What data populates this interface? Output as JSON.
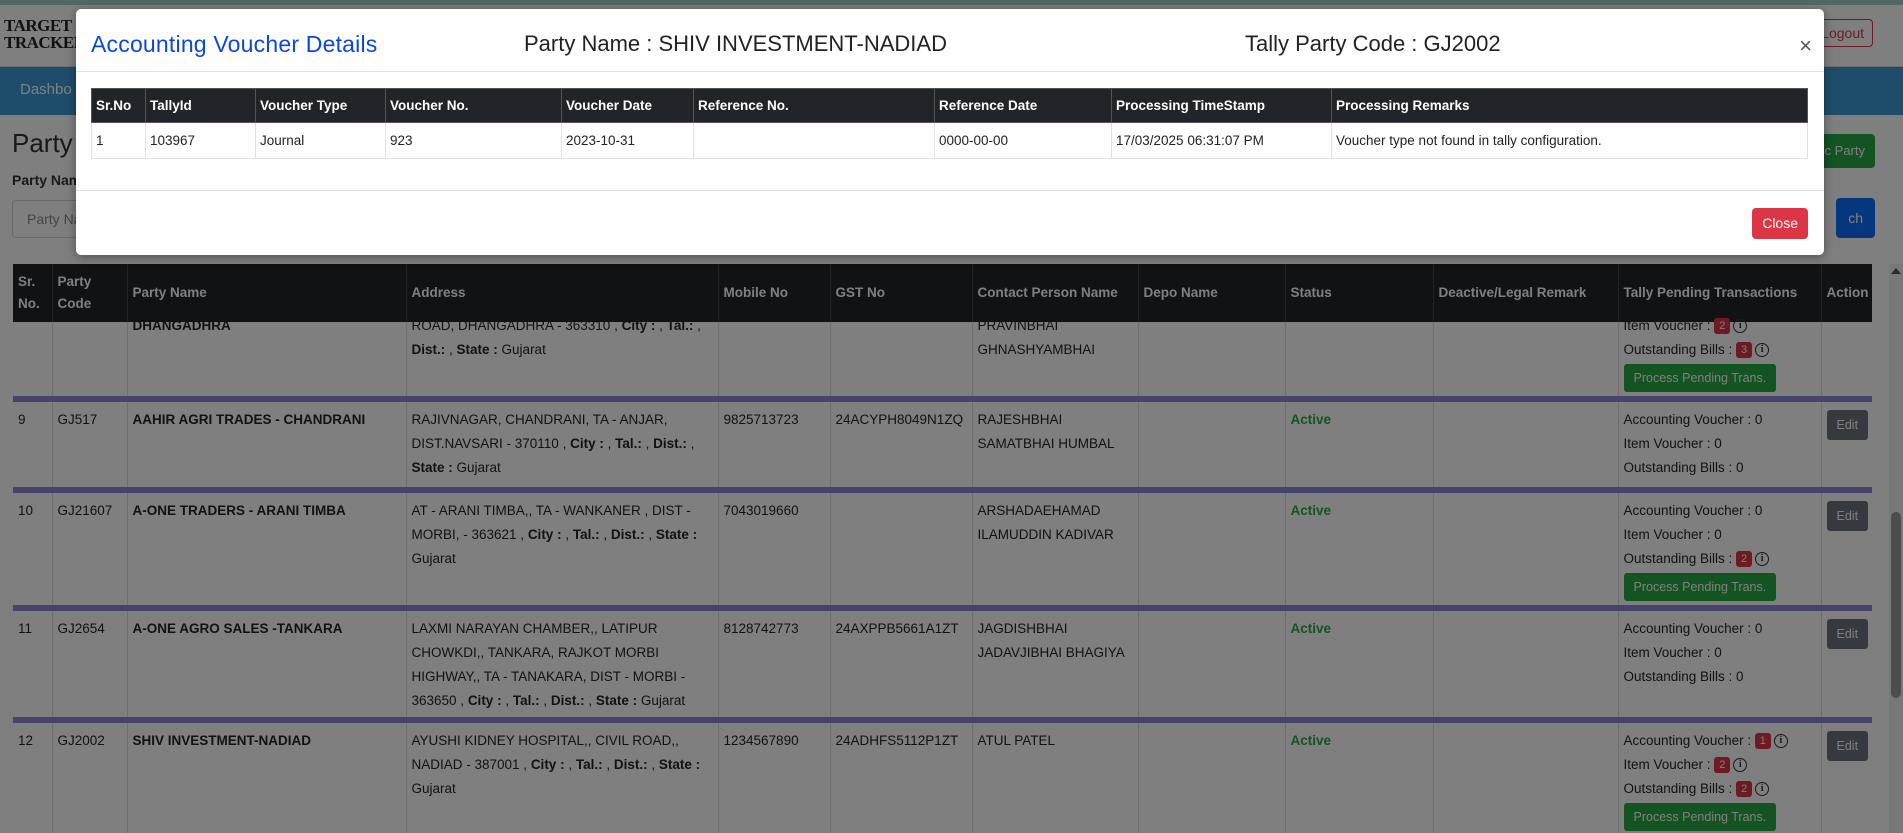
{
  "header": {
    "logo_line1": "TARGET",
    "logo_line2": "TRACKER",
    "logout_label": "Logout"
  },
  "nav": {
    "dashboard_label": "Dashbo"
  },
  "page": {
    "title": "Party",
    "filter_label": "Party Nam",
    "filter_placeholder": "Party Na",
    "add_party_label": "c Party",
    "search_label": "ch"
  },
  "table": {
    "headers": [
      "Sr. No.",
      "Party Code",
      "Party Name",
      "Address",
      "Mobile No",
      "GST No",
      "Contact Person Name",
      "Depo Name",
      "Status",
      "Deactive/Legal Remark",
      "Tally Pending Transactions",
      "Action"
    ],
    "partial_row": {
      "party_name": "DHANGADHRA",
      "address_line1": "ROAD, DHANGADHRA - 363310 , ",
      "address_line2_tail": "Gujarat",
      "contact": "PRAVINBHAI GHNASHYAMBHAI",
      "item_voucher_label": "Item Voucher :",
      "item_voucher_count": "2",
      "outstanding_label": "Outstanding Bills :",
      "outstanding_count": "3",
      "process_label": "Process Pending Trans."
    },
    "rows": [
      {
        "sr": "9",
        "code": "GJ517",
        "name": "AAHIR AGRI TRADES - CHANDRANI",
        "address": "RAJIVNAGAR, CHANDRANI, TA - ANJAR, DIST.NAVSARI - 370110 , ",
        "state": "Gujarat",
        "mobile": "9825713723",
        "gst": "24ACYPH8049N1ZQ",
        "contact": "RAJESHBHAI SAMATBHAI HUMBAL",
        "depo": "",
        "status": "Active",
        "remark": "",
        "accounting": "Accounting Voucher : 0",
        "item": "Item Voucher : 0",
        "outstanding": "Outstanding Bills : 0",
        "edit_label": "Edit"
      },
      {
        "sr": "10",
        "code": "GJ21607",
        "name": "A-ONE TRADERS - ARANI TIMBA",
        "address": "AT - ARANI TIMBA,, TA - WANKANER , DIST - MORBI, - 363621 , ",
        "state": "Gujarat",
        "mobile": "7043019660",
        "gst": "",
        "contact": "ARSHADAEHAMAD ILAMUDDIN KADIVAR",
        "depo": "",
        "status": "Active",
        "remark": "",
        "accounting": "Accounting Voucher : 0",
        "item": "Item Voucher : 0",
        "outstanding_label": "Outstanding Bills :",
        "outstanding_count": "2",
        "process_label": "Process Pending Trans.",
        "edit_label": "Edit"
      },
      {
        "sr": "11",
        "code": "GJ2654",
        "name": "A-ONE AGRO SALES -TANKARA",
        "address": "LAXMI NARAYAN CHAMBER,, LATIPUR CHOWKDI,, TANKARA, RAJKOT MORBI HIGHWAY,, TA - TANAKARA, DIST - MORBI - 363650 , ",
        "state": "Gujarat",
        "mobile": "8128742773",
        "gst": "24AXPPB5661A1ZT",
        "contact": "JAGDISHBHAI JADAVJIBHAI BHAGIYA",
        "depo": "",
        "status": "Active",
        "remark": "",
        "accounting": "Accounting Voucher : 0",
        "item": "Item Voucher : 0",
        "outstanding": "Outstanding Bills : 0",
        "edit_label": "Edit"
      },
      {
        "sr": "12",
        "code": "GJ2002",
        "name": "SHIV INVESTMENT-NADIAD",
        "address": "AYUSHI KIDNEY HOSPITAL,, CIVIL ROAD,, NADIAD - 387001 , ",
        "state": "Gujarat",
        "mobile": "1234567890",
        "gst": "24ADHFS5112P1ZT",
        "contact": "ATUL PATEL",
        "depo": "",
        "status": "Active",
        "remark": "",
        "accounting_label": "Accounting Voucher :",
        "accounting_count": "1",
        "item_label": "Item Voucher :",
        "item_count": "2",
        "outstanding_label": "Outstanding Bills :",
        "outstanding_count": "2",
        "process_label": "Process Pending Trans.",
        "edit_label": "Edit"
      }
    ],
    "addr_labels": {
      "city": "City :",
      "tal": "Tal.:",
      "dist": "Dist.:",
      "state": "State :"
    },
    "addr_sep": " , "
  },
  "modal": {
    "title": "Accounting Voucher Details",
    "party_name": "Party Name : SHIV INVESTMENT-NADIAD",
    "tally_code": "Tally Party Code : GJ2002",
    "close_x": "×",
    "columns": [
      "Sr.No",
      "TallyId",
      "Voucher Type",
      "Voucher No.",
      "Voucher Date",
      "Reference No.",
      "Reference Date",
      "Processing TimeStamp",
      "Processing Remarks"
    ],
    "rows": [
      [
        "1",
        "103967",
        "Journal",
        "923",
        "2023-10-31",
        "",
        "0000-00-00",
        "17/03/2025 06:31:07 PM",
        "Voucher type not found in tally configuration."
      ]
    ],
    "close_label": "Close"
  },
  "colors": {
    "modal_title": "#0d47d9",
    "active": "#28a745",
    "badge": "#dc3545",
    "row_separator": "#8c86d8",
    "header_bg": "#212529"
  }
}
